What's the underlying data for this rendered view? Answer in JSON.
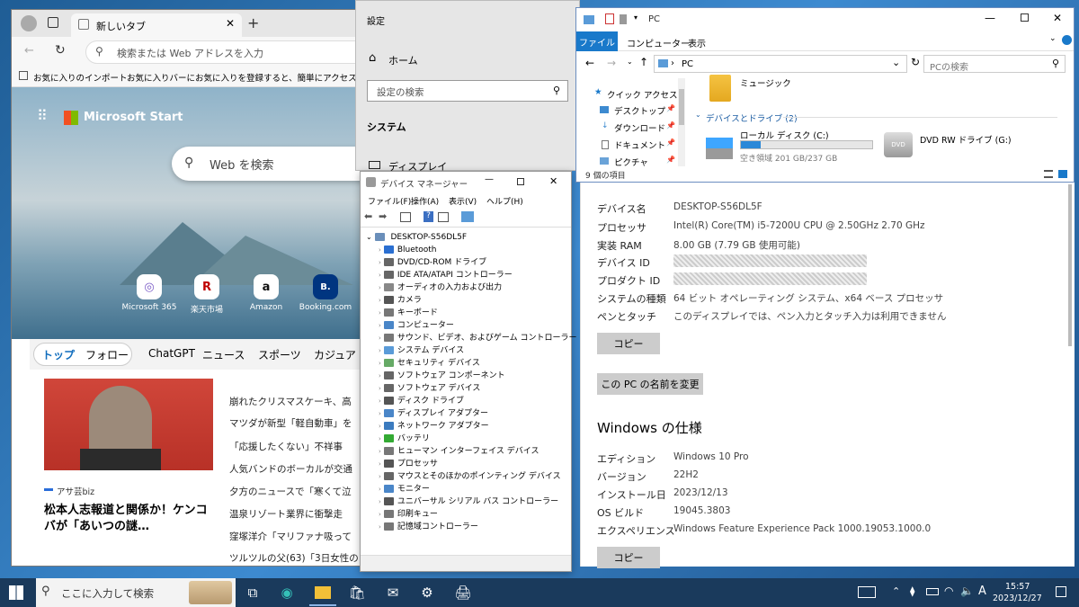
{
  "edge": {
    "tab_title": "新しいタブ",
    "address_placeholder": "検索または Web アドレスを入力",
    "fav_import": "お気に入りのインポート",
    "fav_hint": "お気に入りバーにお気に入りを登録すると、簡単にアクセスできるよう",
    "brand": "Microsoft Start",
    "web_search_placeholder": "Web を検索",
    "quicklinks": [
      {
        "label": "Microsoft 365",
        "glyph": "◎"
      },
      {
        "label": "楽天市場",
        "glyph": "R"
      },
      {
        "label": "Amazon",
        "glyph": "a"
      },
      {
        "label": "Booking.com",
        "glyph": "B."
      }
    ],
    "news_tabs": [
      "トップ",
      "フォロー",
      "ChatGPT",
      "ニュース",
      "スポーツ",
      "カジュア"
    ],
    "source": "アサ芸biz",
    "main_headline": "松本人志報道と関係か！ケンコバが「あいつの謎…",
    "headlines": [
      "崩れたクリスマスケーキ、高",
      "マツダが新型「軽自動車」を",
      "「応援したくない」不祥事",
      "人気バンドのボーカルが交通",
      "夕方のニュースで「寒くて泣",
      "温泉リゾート業界に衝撃走",
      "窪塚洋介「マリファナ吸って",
      "ツルツルの父(63)「3日女性の"
    ]
  },
  "settings": {
    "title": "設定",
    "home": "ホーム",
    "search_placeholder": "設定の検索",
    "system": "システム",
    "display": "ディスプレイ"
  },
  "about": {
    "device_name_label": "デバイス名",
    "device_name": "DESKTOP-S56DL5F",
    "processor_label": "プロセッサ",
    "processor": "Intel(R) Core(TM) i5-7200U CPU @ 2.50GHz   2.70 GHz",
    "ram_label": "実装 RAM",
    "ram": "8.00 GB (7.79 GB 使用可能)",
    "device_id_label": "デバイス ID",
    "product_id_label": "プロダクト ID",
    "system_type_label": "システムの種類",
    "system_type": "64 ビット オペレーティング システム、x64 ベース プロセッサ",
    "pen_label": "ペンとタッチ",
    "pen": "このディスプレイでは、ペン入力とタッチ入力は利用できません",
    "copy_button": "コピー",
    "rename_button": "この PC の名前を変更",
    "windows_spec_heading": "Windows の仕様",
    "edition_label": "エディション",
    "edition": "Windows 10 Pro",
    "version_label": "バージョン",
    "version": "22H2",
    "install_label": "インストール日",
    "install_date": "2023/12/13",
    "build_label": "OS ビルド",
    "build": "19045.3803",
    "experience_label": "エクスペリエンス",
    "experience": "Windows Feature Experience Pack 1000.19053.1000.0",
    "copy_button2": "コピー"
  },
  "explorer": {
    "title": "PC",
    "ribbon_tabs": [
      "ファイル",
      "コンピューター",
      "表示"
    ],
    "path": "PC",
    "search_placeholder": "PCの検索",
    "quick_access": "クイック アクセス",
    "nav_items": [
      "デスクトップ",
      "ダウンロード",
      "ドキュメント",
      "ピクチャ"
    ],
    "music": "ミュージック",
    "drives_header": "デバイスとドライブ (2)",
    "local_disk": "ローカル ディスク (C:)",
    "local_disk_free": "空き領域 201 GB/237 GB",
    "local_disk_used_fraction": 0.15,
    "dvd": "DVD RW ドライブ (G:)",
    "item_count": "9 個の項目"
  },
  "devmgr": {
    "title": "デバイス マネージャー",
    "menu": [
      "ファイル(F)",
      "操作(A)",
      "表示(V)",
      "ヘルプ(H)"
    ],
    "root": "DESKTOP-S56DL5F",
    "items": [
      "Bluetooth",
      "DVD/CD-ROM ドライブ",
      "IDE ATA/ATAPI コントローラー",
      "オーディオの入力および出力",
      "カメラ",
      "キーボード",
      "コンピューター",
      "サウンド、ビデオ、およびゲーム コントローラー",
      "システム デバイス",
      "セキュリティ デバイス",
      "ソフトウェア コンポーネント",
      "ソフトウェア デバイス",
      "ディスク ドライブ",
      "ディスプレイ アダプター",
      "ネットワーク アダプター",
      "バッテリ",
      "ヒューマン インターフェイス デバイス",
      "プロセッサ",
      "マウスとそのほかのポインティング デバイス",
      "モニター",
      "ユニバーサル シリアル バス コントローラー",
      "印刷キュー",
      "記憶域コントローラー"
    ]
  },
  "taskbar": {
    "search_placeholder": "ここに入力して検索",
    "time": "15:57",
    "date": "2023/12/27",
    "ime": "A"
  }
}
